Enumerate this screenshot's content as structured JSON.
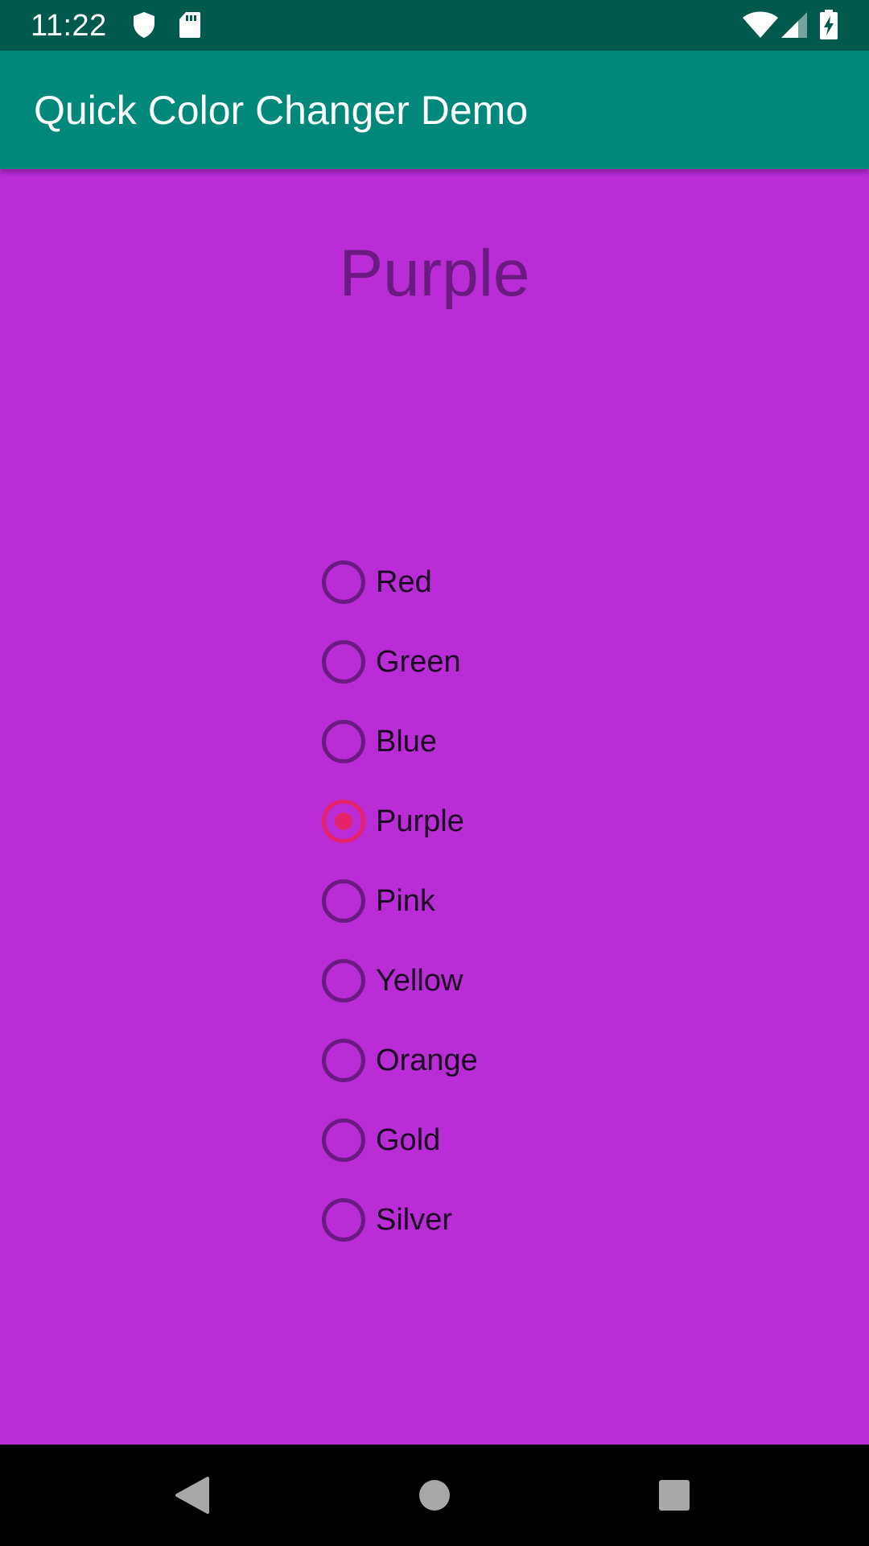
{
  "status_bar": {
    "time": "11:22",
    "icons": [
      "shield-icon",
      "sd-card-icon",
      "wifi-icon",
      "signal-icon",
      "battery-charging-icon"
    ]
  },
  "app_bar": {
    "title": "Quick Color Changer Demo"
  },
  "heading": {
    "text": "Purple"
  },
  "radio_group": {
    "options": [
      {
        "label": "Red",
        "selected": false
      },
      {
        "label": "Green",
        "selected": false
      },
      {
        "label": "Blue",
        "selected": false
      },
      {
        "label": "Purple",
        "selected": true
      },
      {
        "label": "Pink",
        "selected": false
      },
      {
        "label": "Yellow",
        "selected": false
      },
      {
        "label": "Orange",
        "selected": false
      },
      {
        "label": "Gold",
        "selected": false
      },
      {
        "label": "Silver",
        "selected": false
      }
    ]
  },
  "nav_bar": {
    "buttons": [
      "back-icon",
      "home-icon",
      "recents-icon"
    ]
  },
  "colors": {
    "background": "#b92cd6",
    "status_bar": "#00594d",
    "app_bar": "#00897b",
    "accent": "#e5236a",
    "heading_text": "#6a1a80"
  }
}
